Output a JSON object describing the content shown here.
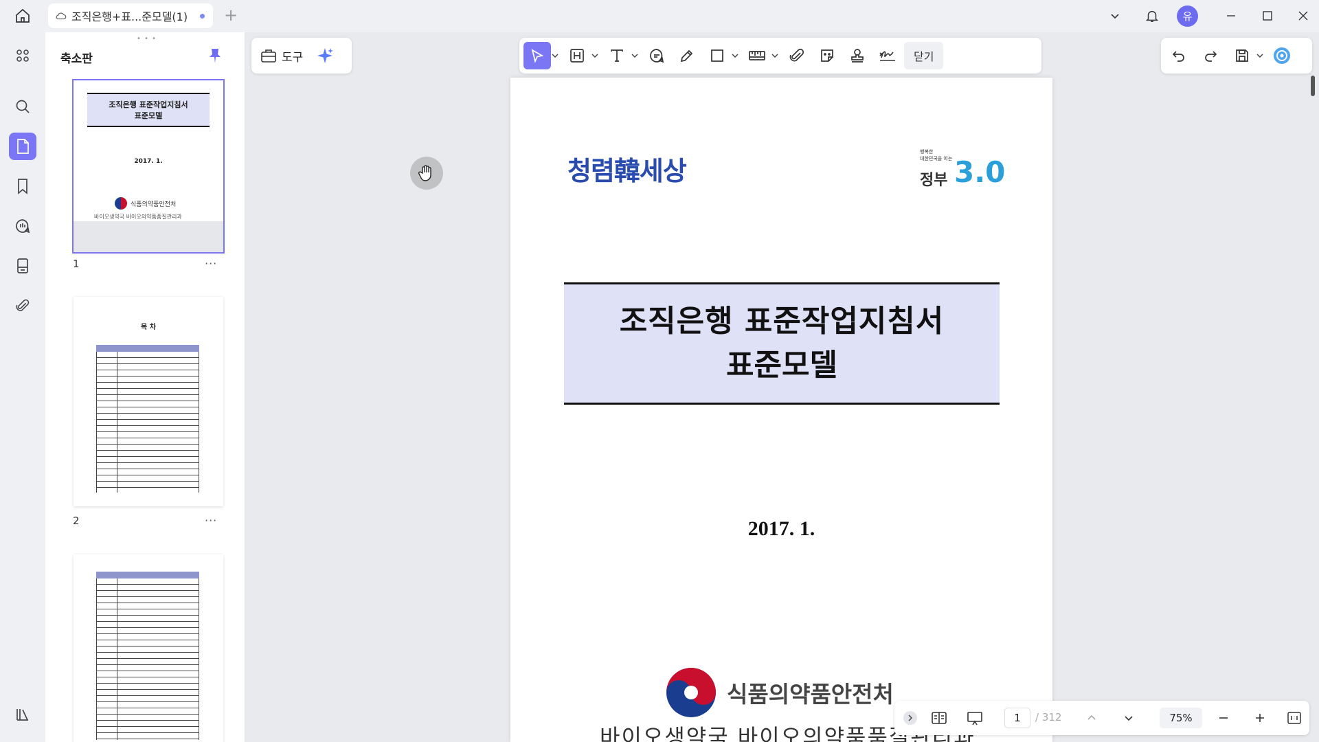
{
  "window": {
    "tab_title": "조직은행+표...준모델(1)",
    "new_tab_symbol": "+",
    "avatar_letter": "유"
  },
  "thumbnail_panel": {
    "title": "축소판",
    "pages": [
      {
        "number": "1",
        "more": "···"
      },
      {
        "number": "2",
        "more": "···"
      }
    ],
    "thumb1": {
      "title_l1": "조직은행 표준작업지침서",
      "title_l2": "표준모델",
      "date": "2017. 1.",
      "ministry": "식품의약품안전처",
      "bureau": "바이오생약국 바이오의약품품질관리과"
    },
    "thumb2": {
      "heading": "목 차"
    }
  },
  "toolbar": {
    "tools_label": "도구",
    "close_label": "닫기"
  },
  "document": {
    "logo_left": "청렴韓세상",
    "logo_right_caption_1": "행복한",
    "logo_right_caption_2": "대한민국을 여는",
    "logo_right_text": "정부",
    "logo_right_number": "3.0",
    "title_line1": "조직은행 표준작업지침서",
    "title_line2": "표준모델",
    "date": "2017.  1.",
    "ministry": "식품의약품안전처",
    "bureau": "바이오생약국 바이오의약품품질관리과"
  },
  "statusbar": {
    "current_page": "1",
    "total_pages": "/ 312",
    "zoom": "75%"
  },
  "colors": {
    "accent": "#7b77f4",
    "title_box_bg": "#dfe1f6"
  }
}
